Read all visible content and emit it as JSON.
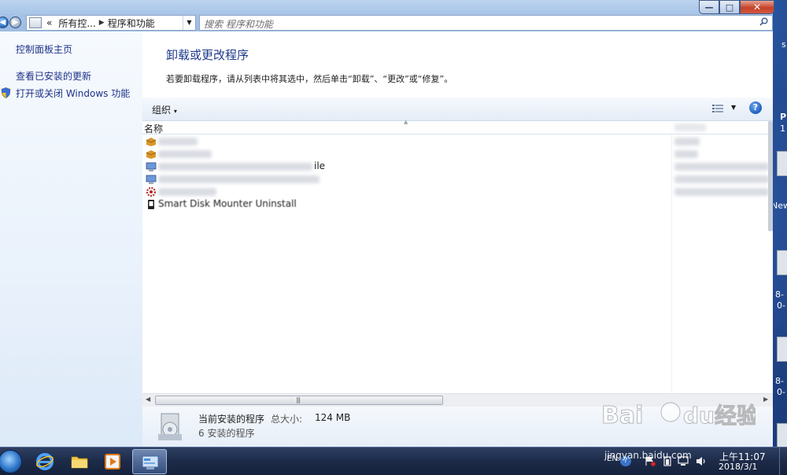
{
  "window": {
    "address": {
      "part1": "所有控...",
      "part2": "程序和功能",
      "prefix": "«"
    },
    "search_placeholder": "搜索 程序和功能",
    "controls": {
      "minimize": "—",
      "maximize": "□",
      "close": "✕"
    }
  },
  "left_panel": {
    "links": [
      {
        "label": "控制面板主页"
      },
      {
        "label": "查看已安装的更新"
      },
      {
        "label": "打开或关闭 Windows 功能"
      }
    ]
  },
  "main": {
    "heading": "卸载或更改程序",
    "instructions": "若要卸载程序，请从列表中将其选中，然后单击“卸载”、“更改”或“修复”。",
    "toolbar": {
      "organize": "组织"
    },
    "columns": {
      "name": "名称"
    },
    "programs": [
      {
        "visible_name": "",
        "tail": ""
      },
      {
        "visible_name": "",
        "tail": ""
      },
      {
        "visible_name": "",
        "tail": "ile"
      },
      {
        "visible_name": "",
        "tail": ""
      },
      {
        "visible_name": "",
        "tail": ""
      },
      {
        "visible_name": "Smart Disk Mounter Uninstall",
        "tail": ""
      }
    ]
  },
  "details": {
    "title": "当前安装的程序",
    "total_size_label": "总大小:",
    "total_size": "124 MB",
    "count": "6 安装的程序"
  },
  "desktop": {
    "new_label": "New"
  },
  "taskbar": {
    "language": "EN",
    "time": "上午11:07",
    "date": "2018/3/1",
    "watermark": "jingyan.baidu.com"
  },
  "colors": {
    "accent": "#1e3b8a",
    "link": "#1e3287",
    "taskbar": "#1d2b49"
  }
}
